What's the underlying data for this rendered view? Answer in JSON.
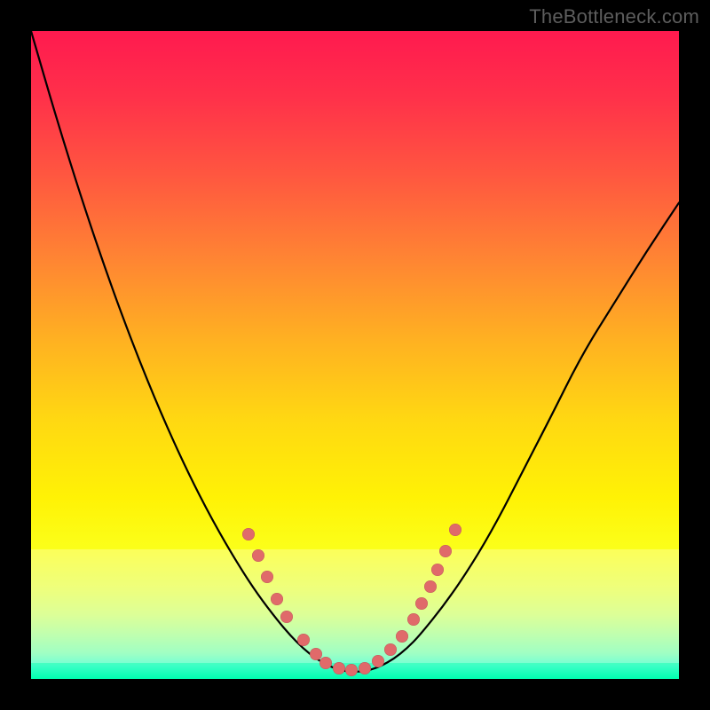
{
  "watermark": "TheBottleneck.com",
  "layout": {
    "image_size": 800,
    "frame_margin": 35,
    "plot_size": 730
  },
  "bands": {
    "pale_top_frac": 0.8,
    "pale_bottom_frac": 0.975
  },
  "colors": {
    "frame": "#000000",
    "watermark": "#5d5d5d",
    "curve": "#000000",
    "dot": "#e06a6a",
    "gradient_stops": [
      "#ff1a4f",
      "#ff304a",
      "#ff5640",
      "#ff8433",
      "#ffb221",
      "#ffd812",
      "#fff205",
      "#fbff1a",
      "#e8ff4a",
      "#d0ff6f",
      "#aaff8f",
      "#7cffad",
      "#3affc6",
      "#00ffb0"
    ]
  },
  "chart_data": {
    "type": "line",
    "title": "",
    "xlabel": "",
    "ylabel": "",
    "xlim": [
      0,
      1
    ],
    "ylim": [
      0,
      1
    ],
    "note": "x is normalized horizontal position across plot, y is 1 - (curve_height / plot_height) i.e. 1 at bottom, 0 at top. Curve is a V with rounded base.",
    "x": [
      0.0,
      0.04,
      0.08,
      0.12,
      0.16,
      0.2,
      0.24,
      0.28,
      0.32,
      0.35,
      0.38,
      0.4,
      0.42,
      0.44,
      0.46,
      0.475,
      0.49,
      0.5,
      0.51,
      0.525,
      0.54,
      0.56,
      0.58,
      0.6,
      0.64,
      0.68,
      0.72,
      0.76,
      0.8,
      0.85,
      0.9,
      0.95,
      1.0
    ],
    "values": [
      0.0,
      0.1375,
      0.2651,
      0.3829,
      0.4908,
      0.5889,
      0.6771,
      0.7555,
      0.824,
      0.8698,
      0.9091,
      0.9327,
      0.953,
      0.969,
      0.98,
      0.9857,
      0.9886,
      0.9886,
      0.9886,
      0.9857,
      0.98,
      0.969,
      0.953,
      0.9327,
      0.8827,
      0.824,
      0.7555,
      0.6771,
      0.6,
      0.5,
      0.42,
      0.34,
      0.265
    ],
    "markers_note": "approximate centers of the salmon dots in normalized plot coords (x, y where y=1 is bottom)",
    "markers": [
      {
        "x": 0.335,
        "y": 0.777
      },
      {
        "x": 0.35,
        "y": 0.81
      },
      {
        "x": 0.365,
        "y": 0.843
      },
      {
        "x": 0.38,
        "y": 0.877
      },
      {
        "x": 0.395,
        "y": 0.904
      },
      {
        "x": 0.42,
        "y": 0.94
      },
      {
        "x": 0.44,
        "y": 0.962
      },
      {
        "x": 0.455,
        "y": 0.975
      },
      {
        "x": 0.475,
        "y": 0.984
      },
      {
        "x": 0.495,
        "y": 0.986
      },
      {
        "x": 0.515,
        "y": 0.984
      },
      {
        "x": 0.535,
        "y": 0.973
      },
      {
        "x": 0.555,
        "y": 0.955
      },
      {
        "x": 0.572,
        "y": 0.934
      },
      {
        "x": 0.59,
        "y": 0.908
      },
      {
        "x": 0.603,
        "y": 0.884
      },
      {
        "x": 0.616,
        "y": 0.858
      },
      {
        "x": 0.627,
        "y": 0.832
      },
      {
        "x": 0.64,
        "y": 0.803
      },
      {
        "x": 0.655,
        "y": 0.77
      }
    ]
  }
}
